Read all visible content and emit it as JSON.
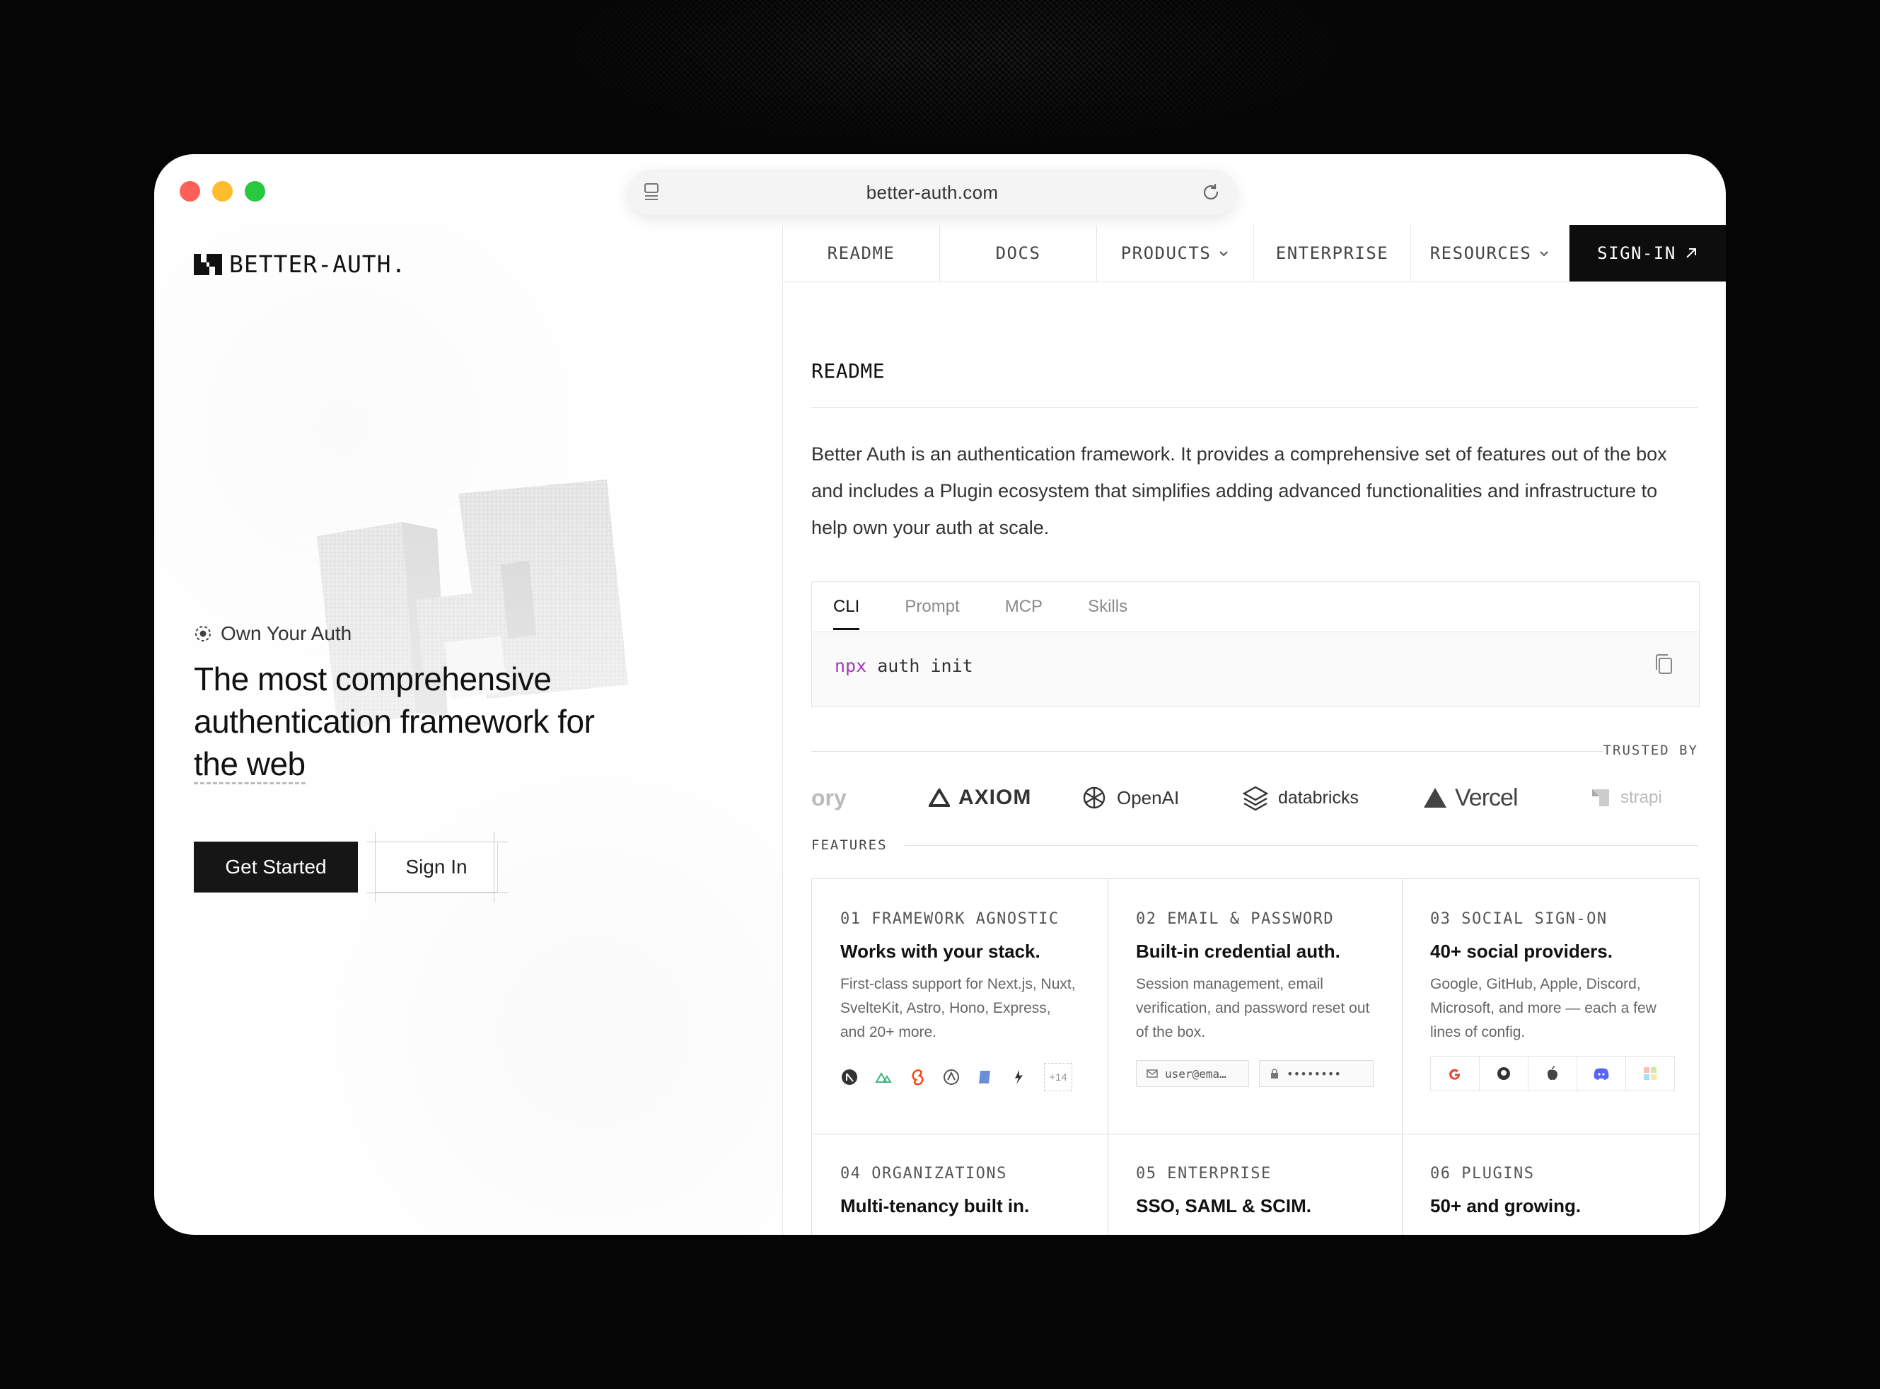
{
  "browser": {
    "url": "better-auth.com"
  },
  "brand": {
    "name": "BETTER-AUTH."
  },
  "hero": {
    "eyebrow": "Own Your Auth",
    "headline_part1": "The most comprehensive authentication framework for ",
    "headline_part2": "the web",
    "primary_cta": "Get Started",
    "secondary_cta": "Sign In"
  },
  "nav": {
    "items": [
      {
        "label": "README"
      },
      {
        "label": "DOCS"
      },
      {
        "label": "PRODUCTS"
      },
      {
        "label": "ENTERPRISE"
      },
      {
        "label": "RESOURCES"
      }
    ],
    "signin": "SIGN-IN"
  },
  "readme": {
    "title": "README",
    "body": "Better Auth is an authentication framework. It provides a comprehensive set of features out of the box and includes a Plugin ecosystem that simplifies adding advanced functionalities and infrastructure to help own your auth at scale."
  },
  "install": {
    "tabs": [
      "CLI",
      "Prompt",
      "MCP",
      "Skills"
    ],
    "active_tab": "CLI",
    "command_prefix": "npx",
    "command_rest": " auth init"
  },
  "trusted": {
    "label": "TRUSTED BY",
    "logos": [
      "ory",
      "AXIOM",
      "OpenAI",
      "databricks",
      "Vercel",
      "strapi"
    ]
  },
  "features": {
    "label": "FEATURES",
    "items": [
      {
        "num": "01 FRAMEWORK AGNOSTIC",
        "title": "Works with your stack.",
        "desc": "First-class support for Next.js, Nuxt, SvelteKit, Astro, Hono, Express, and 20+ more.",
        "extra": "+14"
      },
      {
        "num": "02 EMAIL & PASSWORD",
        "title": "Built-in credential auth.",
        "desc": "Session management, email verification, and password reset out of the box.",
        "email_placeholder": "user@ema…",
        "password_mask": "••••••••"
      },
      {
        "num": "03 SOCIAL SIGN-ON",
        "title": "40+ social providers.",
        "desc": "Google, GitHub, Apple, Discord, Microsoft, and more — each a few lines of config."
      },
      {
        "num": "04 ORGANIZATIONS",
        "title": "Multi-tenancy built in."
      },
      {
        "num": "05 ENTERPRISE",
        "title": "SSO, SAML & SCIM."
      },
      {
        "num": "06 PLUGINS",
        "title": "50+ and growing."
      }
    ]
  },
  "colors": {
    "accent_dark": "#161616",
    "npx_purple": "#a23ab8",
    "traffic_red": "#fe5f57",
    "traffic_yellow": "#febc2e",
    "traffic_green": "#28c840"
  }
}
